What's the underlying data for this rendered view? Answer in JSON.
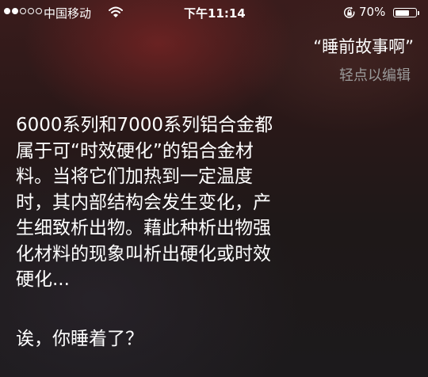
{
  "status_bar": {
    "signal_bars_filled": 2,
    "signal_bars_total": 5,
    "carrier": "中国移动",
    "wifi_icon": "wifi-icon",
    "time": "下午11:14",
    "orientation_lock_icon": "orientation-lock-icon",
    "battery_percent": "70%",
    "battery_level": 0.7
  },
  "siri": {
    "user_query": "“睡前故事啊”",
    "edit_hint": "轻点以编辑",
    "answer_lines": [
      "6000系列和7000系列铝合金都",
      "属于可“时效硬化”的铝合金材",
      "料。当将它们加热到一定温度",
      "时，其内部结构会发生变化，产",
      "生细致析出物。藉此种析出物强",
      "化材料的现象叫析出硬化或时效",
      "硬化..."
    ],
    "followup": "诶，你睡着了？"
  },
  "colors": {
    "text": "#ffffff",
    "hint": "#9a9a9a"
  }
}
